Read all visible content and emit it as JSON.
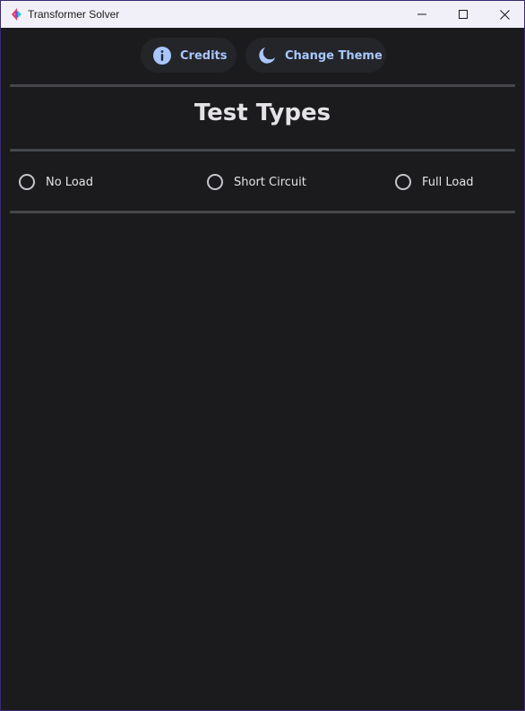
{
  "window": {
    "title": "Transformer Solver",
    "icon": "app-logo-icon"
  },
  "toolbar": {
    "credits_label": "Credits",
    "credits_icon": "info-icon",
    "theme_label": "Change Theme",
    "theme_icon": "moon-icon"
  },
  "main": {
    "heading": "Test Types",
    "test_types": [
      {
        "label": "No Load",
        "selected": false
      },
      {
        "label": "Short Circuit",
        "selected": false
      },
      {
        "label": "Full Load",
        "selected": false
      }
    ]
  },
  "colors": {
    "background": "#1b1b1d",
    "accent": "#a9c7ff",
    "button_bg": "#232529",
    "divider": "#45474b",
    "titlebar": "#f1f0f8"
  }
}
